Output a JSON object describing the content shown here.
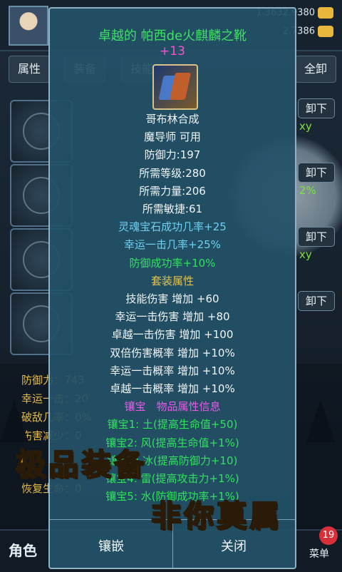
{
  "header": {
    "resources": [
      "1.3632.9380",
      "2.7386"
    ]
  },
  "tabs": [
    "属性",
    "装备",
    "技能",
    "全卸"
  ],
  "slot_button": "卸下",
  "side_texts": [
    "xy",
    "2%",
    "xy"
  ],
  "stats": [
    {
      "label": "防御力：743"
    },
    {
      "label": "幸运一击：20"
    },
    {
      "label": "破敌几率：0%"
    },
    {
      "label": "伤害减少：0"
    },
    {
      "label": "恢复生命：0"
    }
  ],
  "bottom_nav": {
    "role": "角色",
    "menu": "菜单",
    "badge": "19"
  },
  "modal": {
    "title": "卓越的 帕西de火麒麟之靴",
    "enhance": "+13",
    "lines": [
      {
        "text": "哥布林合成",
        "color": "w"
      },
      {
        "text": "魔导师 可用",
        "color": "w"
      },
      {
        "text": "防御力:197",
        "color": "w"
      },
      {
        "text": "所需等级:280",
        "color": "w"
      },
      {
        "text": "所需力量:206",
        "color": "w"
      },
      {
        "text": "所需敏捷:61",
        "color": "w"
      },
      {
        "text": "灵魂宝石成功几率+25",
        "color": "b"
      },
      {
        "text": "幸运一击几率+25%",
        "color": "b"
      },
      {
        "text": "防御成功率+10%",
        "color": "g"
      },
      {
        "text": "套装属性",
        "color": "y"
      },
      {
        "text": "技能伤害 增加 +60",
        "color": "w"
      },
      {
        "text": "幸运一击伤害 增加 +80",
        "color": "w"
      },
      {
        "text": "卓越一击伤害 增加 +100",
        "color": "w"
      },
      {
        "text": "双倍伤害概率 增加 +10%",
        "color": "w"
      },
      {
        "text": "幸运一击概率 增加 +10%",
        "color": "w"
      },
      {
        "text": "卓越一击概率 增加 +10%",
        "color": "w"
      },
      {
        "text": "镶宝　物品属性信息",
        "color": "p"
      },
      {
        "text": "镶宝1: 土(提高生命值+50)",
        "color": "g"
      },
      {
        "text": "镶宝2: 风(提高生命值+1%)",
        "color": "g"
      },
      {
        "text": "镶宝3: 冰(提高防御力+10)",
        "color": "g"
      },
      {
        "text": "镶宝4: 雷(提高攻击力+1%)",
        "color": "g"
      },
      {
        "text": "镶宝5: 水(防御成功率+1%)",
        "color": "g"
      }
    ],
    "buttons": {
      "inlay": "镶嵌",
      "close": "关闭"
    }
  },
  "promo": {
    "line1": "极品装备",
    "line2": "非你莫属"
  }
}
